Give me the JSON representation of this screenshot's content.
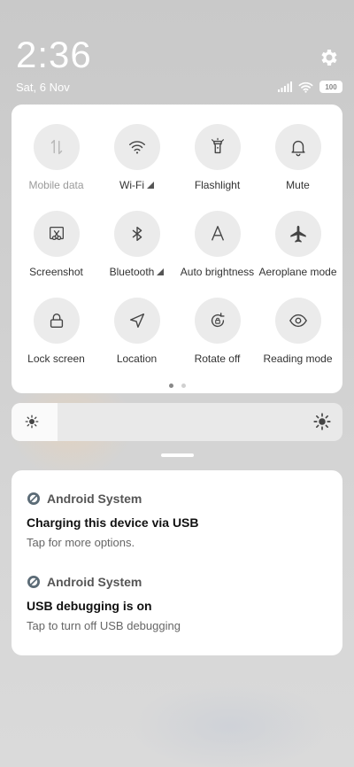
{
  "status": {
    "time": "2:36",
    "date": "Sat, 6 Nov",
    "battery": "100",
    "icons": [
      "signal-icon",
      "wifi-icon",
      "battery-icon"
    ]
  },
  "quick_settings": {
    "tiles": [
      {
        "label": "Mobile data",
        "icon": "mobile-data-icon",
        "active": false,
        "dim": true
      },
      {
        "label": "Wi-Fi",
        "icon": "wifi-icon",
        "expandable": true
      },
      {
        "label": "Flashlight",
        "icon": "flashlight-icon"
      },
      {
        "label": "Mute",
        "icon": "bell-icon"
      },
      {
        "label": "Screenshot",
        "icon": "screenshot-icon"
      },
      {
        "label": "Bluetooth",
        "icon": "bluetooth-icon",
        "expandable": true
      },
      {
        "label": "Auto brightness",
        "icon": "auto-brightness-icon"
      },
      {
        "label": "Aeroplane mode",
        "icon": "airplane-icon"
      },
      {
        "label": "Lock screen",
        "icon": "lock-icon"
      },
      {
        "label": "Location",
        "icon": "location-icon"
      },
      {
        "label": "Rotate off",
        "icon": "rotate-lock-icon"
      },
      {
        "label": "Reading mode",
        "icon": "eye-icon"
      }
    ],
    "page": 1,
    "pages": 2
  },
  "brightness": {
    "level": 0.14
  },
  "notifications": [
    {
      "app": "Android System",
      "title": "Charging this device via USB",
      "text": "Tap for more options."
    },
    {
      "app": "Android System",
      "title": "USB debugging is on",
      "text": "Tap to turn off USB debugging"
    }
  ],
  "colors": {
    "panel": "#ffffff",
    "tile_bg": "#ebebeb",
    "background": "#cfcfcf"
  }
}
